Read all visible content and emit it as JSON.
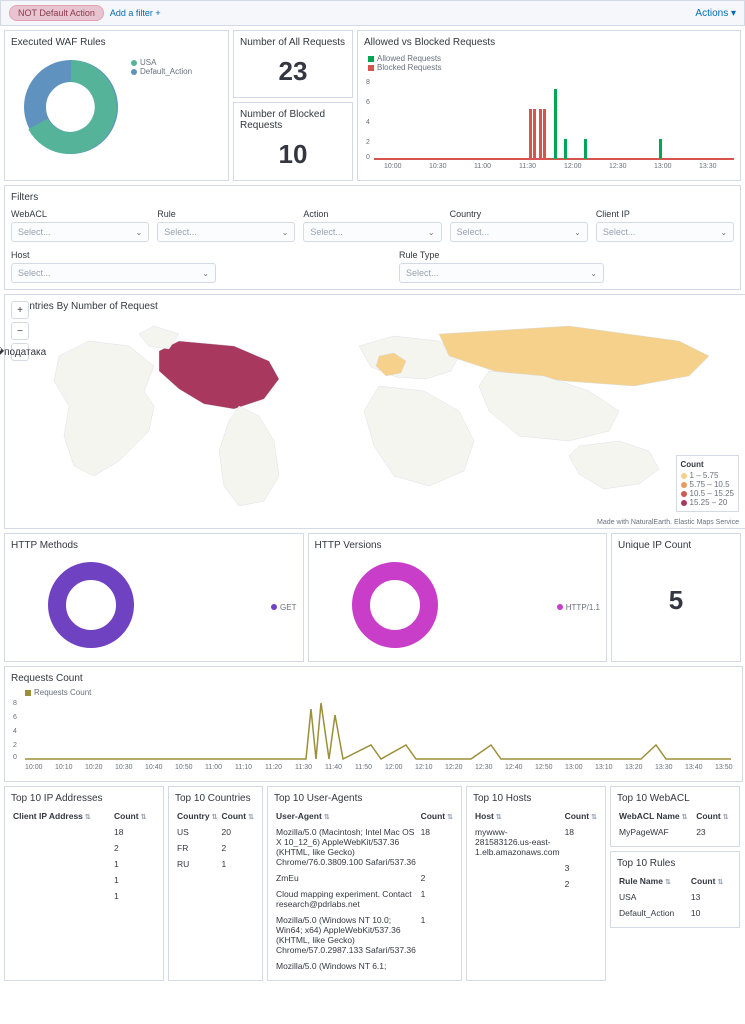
{
  "topbar": {
    "filter_pill": "NOT Default Action",
    "add_filter": "Add a filter +",
    "actions": "Actions ▾"
  },
  "panels": {
    "executed_waf": "Executed WAF Rules",
    "num_all": "Number of All Requests",
    "num_blocked": "Number of Blocked Requests",
    "allowed_blocked": "Allowed vs Blocked Requests",
    "filters": "Filters",
    "countries_map": "Countries By Number of Request",
    "http_methods": "HTTP Methods",
    "http_versions": "HTTP Versions",
    "unique_ip": "Unique IP Count",
    "requests_count": "Requests Count",
    "top_ip": "Top 10 IP Addresses",
    "top_countries": "Top 10 Countries",
    "top_ua": "Top 10 User-Agents",
    "top_hosts": "Top 10 Hosts",
    "top_webacl": "Top 10 WebACL",
    "top_rules": "Top 10 Rules"
  },
  "stats": {
    "all_requests": "23",
    "blocked_requests": "10",
    "unique_ip": "5"
  },
  "waf_legend": {
    "a": "USA",
    "b": "Default_Action"
  },
  "ab_legend": {
    "allowed": "Allowed Requests",
    "blocked": "Blocked Requests"
  },
  "http_methods_legend": "GET",
  "http_versions_legend": "HTTP/1.1",
  "requests_count_legend": "Requests Count",
  "filters_labels": {
    "webacl": "WebACL",
    "rule": "Rule",
    "action": "Action",
    "country": "Country",
    "clientip": "Client IP",
    "host": "Host",
    "ruletype": "Rule Type"
  },
  "select_placeholder": "Select...",
  "map_legend": {
    "title": "Count",
    "r1": "1 – 5.75",
    "r2": "5.75 – 10.5",
    "r3": "10.5 – 15.25",
    "r4": "15.25 – 20"
  },
  "map_attrib": "Made with NaturalEarth. Elastic Maps Service",
  "columns": {
    "clientip": "Client IP Address",
    "count": "Count",
    "country": "Country",
    "ua": "User-Agent",
    "host": "Host",
    "webacl": "WebACL Name",
    "rulename": "Rule Name"
  },
  "top_ip_rows": [
    {
      "ip": "",
      "count": "18"
    },
    {
      "ip": "",
      "count": "2"
    },
    {
      "ip": "",
      "count": "1"
    },
    {
      "ip": "",
      "count": "1"
    },
    {
      "ip": "",
      "count": "1"
    }
  ],
  "top_country_rows": [
    {
      "c": "US",
      "count": "20"
    },
    {
      "c": "FR",
      "count": "2"
    },
    {
      "c": "RU",
      "count": "1"
    }
  ],
  "top_ua_rows": [
    {
      "ua": "Mozilla/5.0 (Macintosh; Intel Mac OS X 10_12_6) AppleWebKit/537.36 (KHTML, like Gecko) Chrome/76.0.3809.100 Safari/537.36",
      "count": "18"
    },
    {
      "ua": "ZmEu",
      "count": "2"
    },
    {
      "ua": "Cloud mapping experiment. Contact research@pdrlabs.net",
      "count": "1"
    },
    {
      "ua": "Mozilla/5.0 (Windows NT 10.0; Win64; x64) AppleWebKit/537.36 (KHTML, like Gecko) Chrome/57.0.2987.133 Safari/537.36",
      "count": "1"
    },
    {
      "ua": "Mozilla/5.0 (Windows NT 6.1;",
      "count": ""
    }
  ],
  "top_hosts_rows": [
    {
      "h": "mywww-281583126.us-east-1.elb.amazonaws.com",
      "count": "18"
    },
    {
      "h": "",
      "count": "3"
    },
    {
      "h": "",
      "count": "2"
    }
  ],
  "top_webacl_rows": [
    {
      "n": "MyPageWAF",
      "count": "23"
    }
  ],
  "top_rules_rows": [
    {
      "n": "USA",
      "count": "13"
    },
    {
      "n": "Default_Action",
      "count": "10"
    }
  ],
  "chart_data": [
    {
      "id": "executed-waf-rules",
      "type": "pie",
      "series": [
        {
          "name": "USA",
          "value": 13,
          "color": "#54b399"
        },
        {
          "name": "Default_Action",
          "value": 10,
          "color": "#6092c0"
        }
      ]
    },
    {
      "id": "allowed-vs-blocked",
      "type": "bar",
      "x": [
        "10:00",
        "10:30",
        "11:00",
        "11:30",
        "11:35",
        "11:40",
        "11:50",
        "12:00",
        "12:30",
        "13:00",
        "13:30"
      ],
      "series": [
        {
          "name": "Allowed Requests",
          "color": "#00a651",
          "values": [
            0,
            0,
            0,
            0,
            0,
            7,
            2,
            2,
            0,
            2,
            0
          ]
        },
        {
          "name": "Blocked Requests",
          "color": "#d9534f",
          "values": [
            0,
            0,
            0,
            5,
            5,
            0,
            0,
            0,
            0,
            0,
            0
          ]
        }
      ],
      "ylim": [
        0,
        8
      ]
    },
    {
      "id": "http-methods",
      "type": "pie",
      "series": [
        {
          "name": "GET",
          "value": 23,
          "color": "#6f42c1"
        }
      ]
    },
    {
      "id": "http-versions",
      "type": "pie",
      "series": [
        {
          "name": "HTTP/1.1",
          "value": 23,
          "color": "#c93ec9"
        }
      ]
    },
    {
      "id": "requests-count",
      "type": "line",
      "color": "#9b8f3a",
      "x": [
        "10:00",
        "10:10",
        "10:20",
        "10:30",
        "10:40",
        "10:50",
        "11:00",
        "11:10",
        "11:20",
        "11:30",
        "11:40",
        "11:50",
        "12:00",
        "12:10",
        "12:20",
        "12:30",
        "12:40",
        "12:50",
        "13:00",
        "13:10",
        "13:20",
        "13:30",
        "13:40",
        "13:50"
      ],
      "values": [
        0,
        0,
        0,
        0,
        0,
        0,
        0,
        0,
        0,
        7,
        8,
        2,
        2,
        0,
        0,
        0,
        2,
        0,
        0,
        0,
        0,
        2,
        0,
        0
      ],
      "ylim": [
        0,
        8
      ]
    }
  ]
}
